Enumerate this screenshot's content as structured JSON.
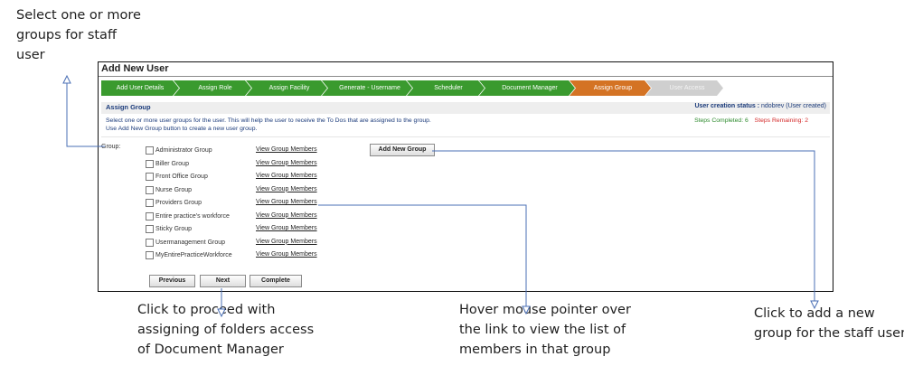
{
  "callouts": {
    "select_groups": "Select one or more groups for staff user",
    "next_hint": "Click to proceed  with assigning of folders access of Document Manager",
    "hover_hint": "Hover mouse pointer over the link to view the list of members in that group",
    "add_hint": "Click to add a new group for the staff user"
  },
  "window": {
    "title": "Add New User"
  },
  "wizard": {
    "steps": [
      {
        "label": "Add User Details",
        "state": "done"
      },
      {
        "label": "Assign Role",
        "state": "done"
      },
      {
        "label": "Assign Facility",
        "state": "done"
      },
      {
        "label": "Generate - Username",
        "state": "done"
      },
      {
        "label": "Scheduler",
        "state": "done"
      },
      {
        "label": "Document Manager",
        "state": "done"
      },
      {
        "label": "Assign Group",
        "state": "current"
      },
      {
        "label": "User Access",
        "state": "todo"
      }
    ],
    "colors": {
      "done": "#3a9a2e",
      "current": "#d47324",
      "todo": "#cfcfcf"
    }
  },
  "section": {
    "title": "Assign Group",
    "status_label": "User creation status :",
    "status_value": "ndobrev (User created)",
    "help_line1": "Select one or more user groups for the user. This will help the user to receive the To Dos that are assigned to the group.",
    "help_line2": "Use Add New Group button to create a new user group.",
    "steps_completed": "Steps Completed: 6",
    "steps_remaining": "Steps Remaining: 2"
  },
  "groups": {
    "label": "Group:",
    "link_text": "View Group Members",
    "items": [
      "Administrator Group",
      "Biller Group",
      "Front Office Group",
      "Nurse Group",
      "Providers Group",
      "Entire practice's workforce",
      "Sticky Group",
      "Usermanagement Group",
      "MyEntirePracticeWorkforce"
    ]
  },
  "buttons": {
    "add_new_group": "Add New Group",
    "previous": "Previous",
    "next": "Next",
    "complete": "Complete"
  }
}
